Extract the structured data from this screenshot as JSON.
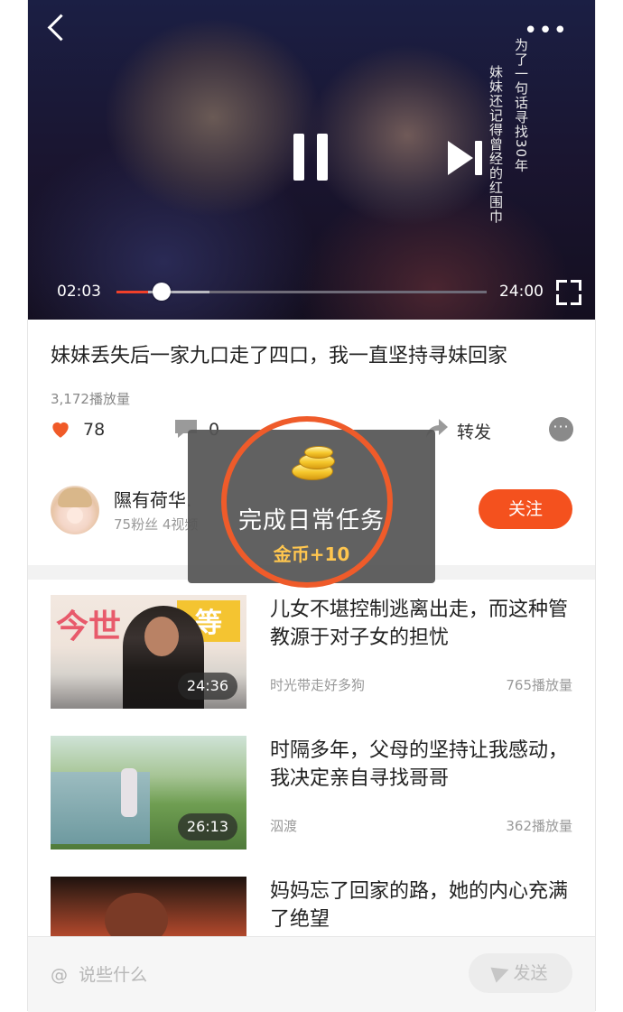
{
  "video": {
    "caption_col1": "为了一句话寻找30年",
    "caption_col2": "妹妹还记得曾经的红围巾",
    "current_time": "02:03",
    "duration": "24:00",
    "progress": 0.085,
    "buffered": 0.25
  },
  "post": {
    "title": "妹妹丢失后一家九口走了四口，我一直坚持寻妹回家",
    "views": "3,172播放量",
    "likes": "78",
    "comments": "0",
    "share_label": "转发"
  },
  "author": {
    "name": "隰有荷华.",
    "meta": "75粉丝  4视频",
    "follow_label": "关注"
  },
  "toast": {
    "title": "完成日常任务",
    "reward": "金币+10"
  },
  "related": [
    {
      "title": "儿女不堪控制逃离出走，而这种管教源于对子女的担忧",
      "source": "时光带走好多狗",
      "views": "765播放量",
      "duration": "24:36"
    },
    {
      "title": "时隔多年，父母的坚持让我感动，我决定亲自寻找哥哥",
      "source": "泅渡",
      "views": "362播放量",
      "duration": "26:13"
    },
    {
      "title": "妈妈忘了回家的路，她的内心充满了绝望",
      "source": "",
      "views": "",
      "duration": ""
    }
  ],
  "comment_bar": {
    "placeholder": "@  说些什么",
    "send_label": "发送"
  },
  "colors": {
    "accent": "#f4511e",
    "reward": "#ffc64f"
  }
}
